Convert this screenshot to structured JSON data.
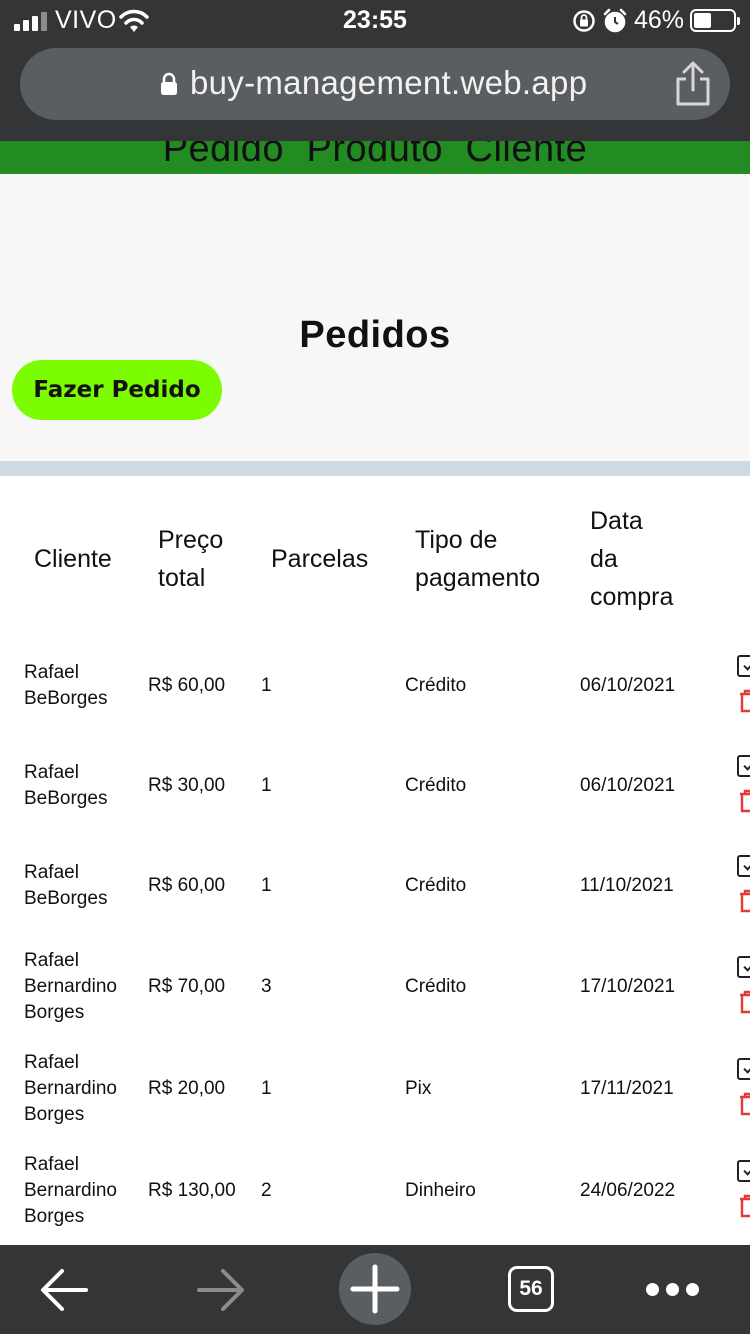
{
  "status_bar": {
    "carrier": "VIVO",
    "time": "23:55",
    "battery_percent": "46%",
    "battery_level": 0.46
  },
  "browser": {
    "url": "buy-management.web.app",
    "tab_count": "56"
  },
  "nav": {
    "links": [
      "Pedido",
      "Produto",
      "Cliente"
    ]
  },
  "page": {
    "title": "Pedidos",
    "order_button": "Fazer Pedido"
  },
  "table": {
    "headers": {
      "cliente": [
        "Cliente"
      ],
      "preco": [
        "Preço",
        "total"
      ],
      "parcelas": [
        "Parcelas"
      ],
      "tipo": [
        "Tipo de",
        "pagamento"
      ],
      "data": [
        "Data",
        "da",
        "compra"
      ]
    },
    "rows": [
      {
        "cliente": [
          "Rafael",
          "BeBorges"
        ],
        "preco": "R$ 60,00",
        "parcelas": "1",
        "tipo": "Crédito",
        "data": "06/10/2021"
      },
      {
        "cliente": [
          "Rafael",
          "BeBorges"
        ],
        "preco": "R$ 30,00",
        "parcelas": "1",
        "tipo": "Crédito",
        "data": "06/10/2021"
      },
      {
        "cliente": [
          "Rafael",
          "BeBorges"
        ],
        "preco": "R$ 60,00",
        "parcelas": "1",
        "tipo": "Crédito",
        "data": "11/10/2021"
      },
      {
        "cliente": [
          "Rafael",
          "Bernardino",
          "Borges"
        ],
        "preco": "R$ 70,00",
        "parcelas": "3",
        "tipo": "Crédito",
        "data": "17/10/2021"
      },
      {
        "cliente": [
          "Rafael",
          "Bernardino",
          "Borges"
        ],
        "preco": "R$ 20,00",
        "parcelas": "1",
        "tipo": "Pix",
        "data": "17/11/2021"
      },
      {
        "cliente": [
          "Rafael",
          "Bernardino",
          "Borges"
        ],
        "preco": "R$ 130,00",
        "parcelas": "2",
        "tipo": "Dinheiro",
        "data": "24/06/2022"
      }
    ]
  },
  "colors": {
    "nav_green": "#228b22",
    "button_green": "#7cfc00",
    "delete_red": "#e53935"
  },
  "icons": [
    "lock-icon",
    "share-icon",
    "edit-icon",
    "trash-icon",
    "back-arrow-icon",
    "forward-arrow-icon",
    "plus-icon",
    "more-icon",
    "wifi-icon",
    "alarm-icon",
    "rotation-lock-icon"
  ]
}
